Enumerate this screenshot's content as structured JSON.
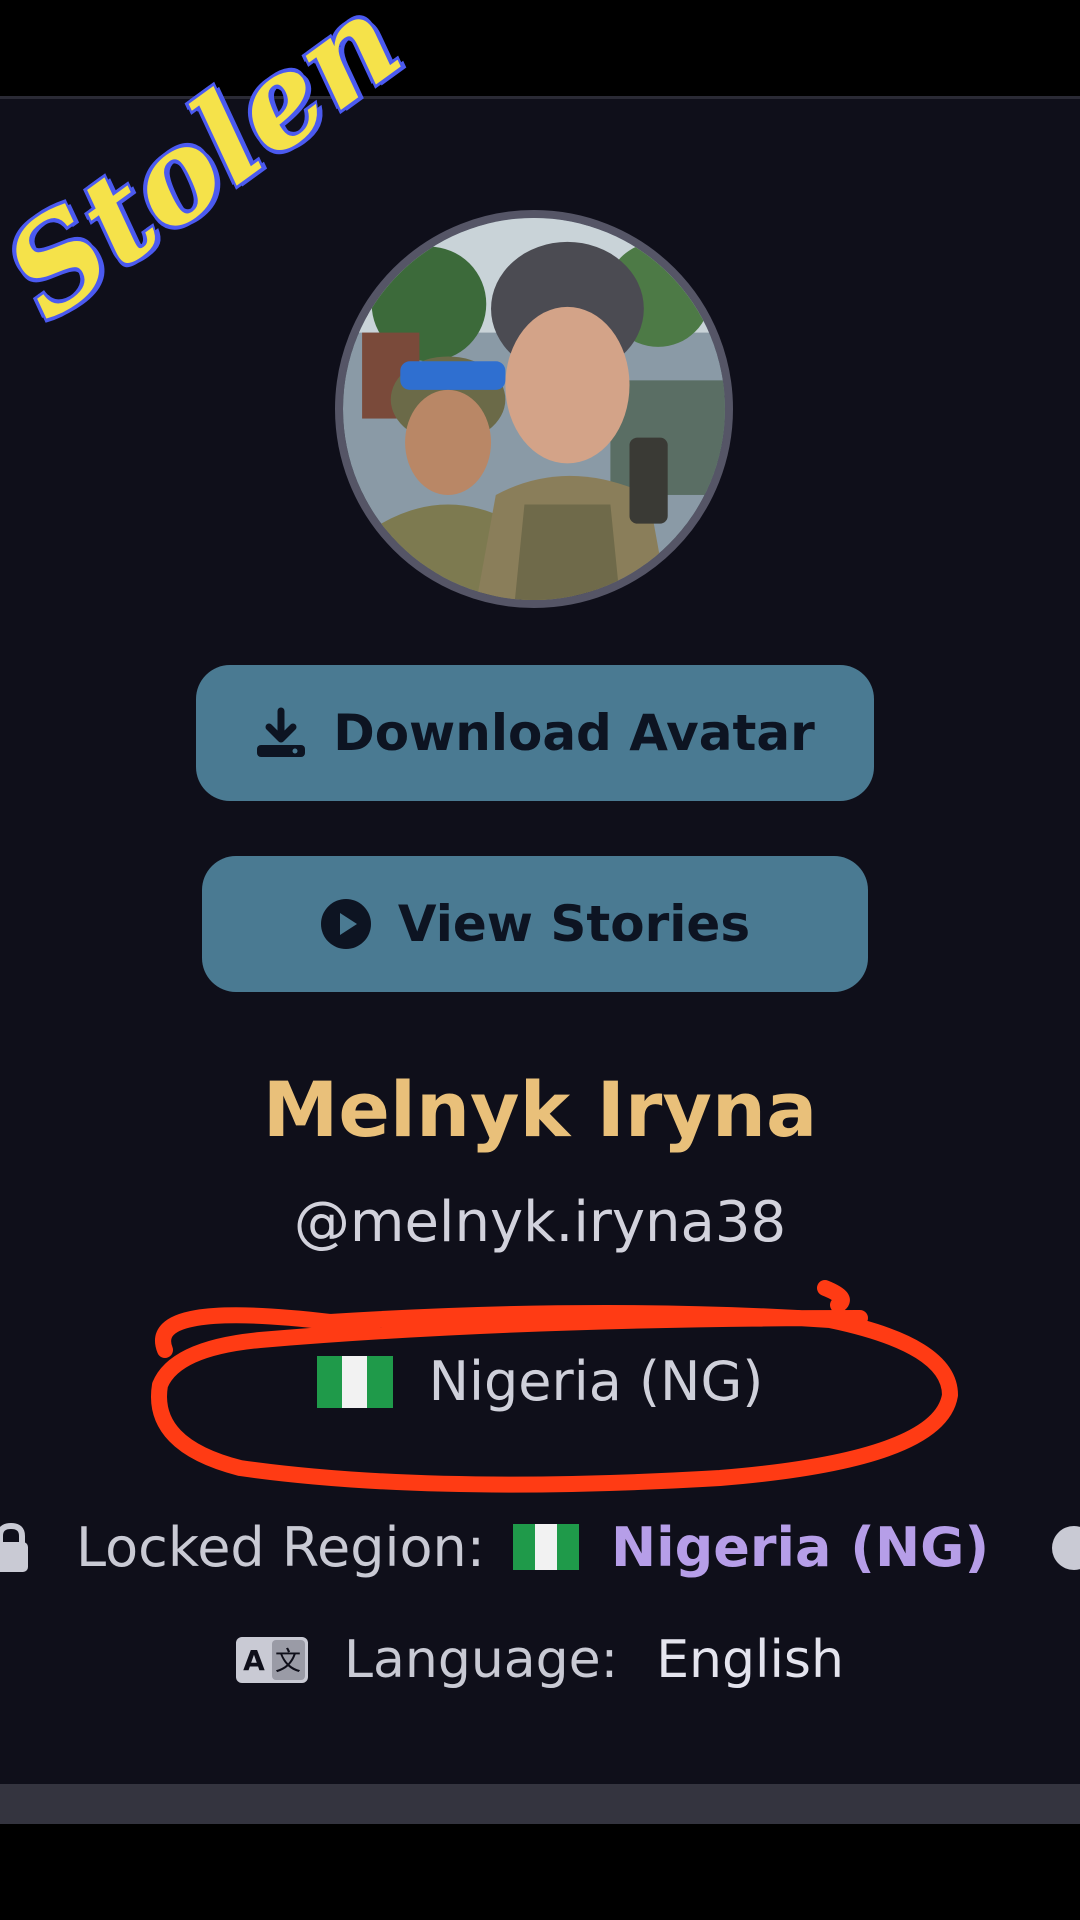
{
  "watermark": {
    "text": "Stolen"
  },
  "profile": {
    "avatar": "profile-photo",
    "download_label": "Download Avatar",
    "stories_label": "View Stories",
    "name": "Melnyk Iryna",
    "handle": "@melnyk.iryna38",
    "country": "Nigeria (NG)",
    "country_flag": "nigeria-flag"
  },
  "details": {
    "locked_region_label": "Locked Region:",
    "locked_region_value": "Nigeria (NG)",
    "language_label": "Language:",
    "language_value": "English"
  },
  "colors": {
    "background": "#0f0f1a",
    "button": "#4a7a92",
    "name": "#e9c07a",
    "region_value": "#b69ee8",
    "highlight_circle": "#ff3b14",
    "watermark_fill": "#f5e24a",
    "watermark_outline": "#4b5af0"
  },
  "icons": {
    "download": "download-icon",
    "play": "play-circle-icon",
    "lock": "lock-icon",
    "language": "translate-icon"
  }
}
